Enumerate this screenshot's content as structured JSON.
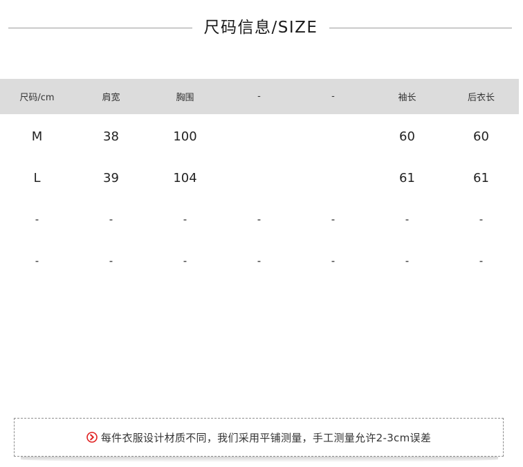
{
  "title": "尺码信息/SIZE",
  "table": {
    "headers": [
      "尺码/cm",
      "肩宽",
      "胸围",
      "-",
      "-",
      "袖长",
      "后衣长"
    ],
    "rows": [
      [
        "M",
        "38",
        "100",
        "",
        "",
        "60",
        "60"
      ],
      [
        "L",
        "39",
        "104",
        "",
        "",
        "61",
        "61"
      ],
      [
        "-",
        "-",
        "-",
        "-",
        "-",
        "-",
        "-"
      ],
      [
        "-",
        "-",
        "-",
        "-",
        "-",
        "-",
        "-"
      ]
    ]
  },
  "note": {
    "icon": "chevron-right-circle-icon",
    "icon_color": "#e02020",
    "text": "每件衣服设计材质不同，我们采用平铺测量，手工测量允许2-3cm误差"
  },
  "colors": {
    "header_bg": "#dcdcdc",
    "accent": "#e02020"
  }
}
